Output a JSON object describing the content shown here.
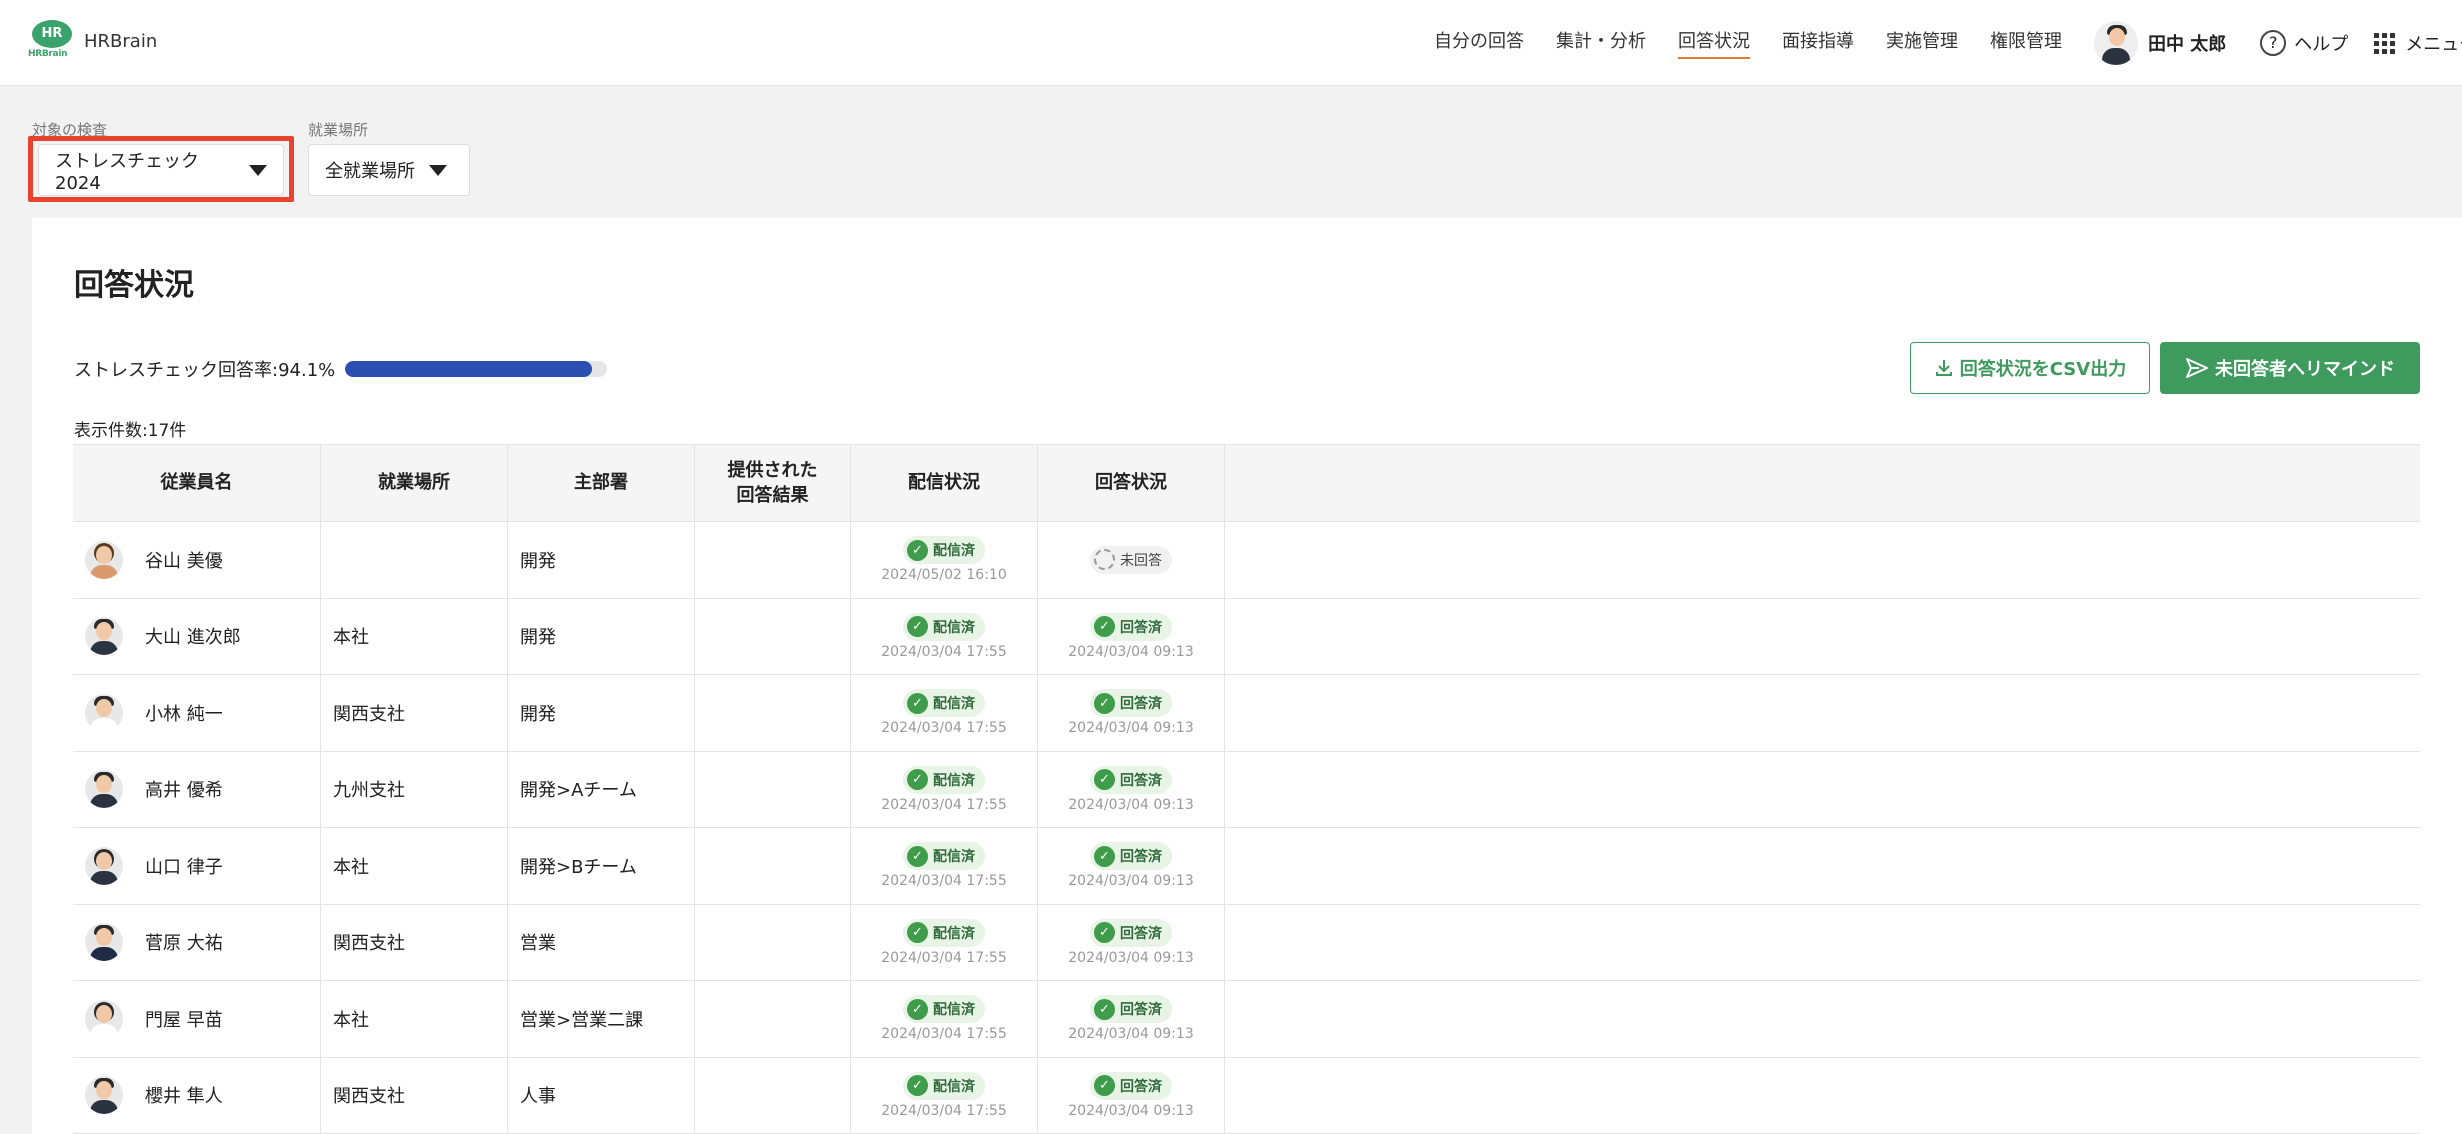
{
  "header": {
    "logo_mark": "HR",
    "logo_sub": "HRBrain",
    "app_name": "HRBrain",
    "nav": [
      "自分の回答",
      "集計・分析",
      "回答状況",
      "面接指導",
      "実施管理",
      "権限管理"
    ],
    "active_nav": "回答状況",
    "user_name": "田中 太郎",
    "help_label": "ヘルプ",
    "menu_label": "メニュー"
  },
  "filters": {
    "exam_label": "対象の検査",
    "exam_value": "ストレスチェック2024",
    "site_label": "就業場所",
    "site_value": "全就業場所"
  },
  "main": {
    "title": "回答状況",
    "rate_label": "ストレスチェック回答率:94.1%",
    "rate_value": 0.941,
    "count_label": "表示件数:17件",
    "csv_button": "回答状況をCSV出力",
    "remind_button": "未回答者へリマインド"
  },
  "table": {
    "headers": [
      "従業員名",
      "就業場所",
      "主部署",
      "提供された\n回答結果",
      "配信状況",
      "回答状況"
    ],
    "rows": [
      {
        "name": "谷山 美優",
        "site": "",
        "dept": "開発",
        "delivery": "配信済",
        "delivery_date": "2024/05/02 16:10",
        "answer": "未回答",
        "answer_date": ""
      },
      {
        "name": "大山 進次郎",
        "site": "本社",
        "dept": "開発",
        "delivery": "配信済",
        "delivery_date": "2024/03/04 17:55",
        "answer": "回答済",
        "answer_date": "2024/03/04 09:13"
      },
      {
        "name": "小林 純一",
        "site": "関西支社",
        "dept": "開発",
        "delivery": "配信済",
        "delivery_date": "2024/03/04 17:55",
        "answer": "回答済",
        "answer_date": "2024/03/04 09:13"
      },
      {
        "name": "高井 優希",
        "site": "九州支社",
        "dept": "開発>Aチーム",
        "delivery": "配信済",
        "delivery_date": "2024/03/04 17:55",
        "answer": "回答済",
        "answer_date": "2024/03/04 09:13"
      },
      {
        "name": "山口 律子",
        "site": "本社",
        "dept": "開発>Bチーム",
        "delivery": "配信済",
        "delivery_date": "2024/03/04 17:55",
        "answer": "回答済",
        "answer_date": "2024/03/04 09:13"
      },
      {
        "name": "菅原 大祐",
        "site": "関西支社",
        "dept": "営業",
        "delivery": "配信済",
        "delivery_date": "2024/03/04 17:55",
        "answer": "回答済",
        "answer_date": "2024/03/04 09:13"
      },
      {
        "name": "門屋 早苗",
        "site": "本社",
        "dept": "営業>営業二課",
        "delivery": "配信済",
        "delivery_date": "2024/03/04 17:55",
        "answer": "回答済",
        "answer_date": "2024/03/04 09:13"
      },
      {
        "name": "櫻井 隼人",
        "site": "関西支社",
        "dept": "人事",
        "delivery": "配信済",
        "delivery_date": "2024/03/04 17:55",
        "answer": "回答済",
        "answer_date": "2024/03/04 09:13"
      }
    ]
  },
  "colors": {
    "brand_green": "#3f9a5e",
    "progress_blue": "#2b4fb0",
    "highlight_red": "#e8432f",
    "active_nav_underline": "#e07a2c"
  }
}
